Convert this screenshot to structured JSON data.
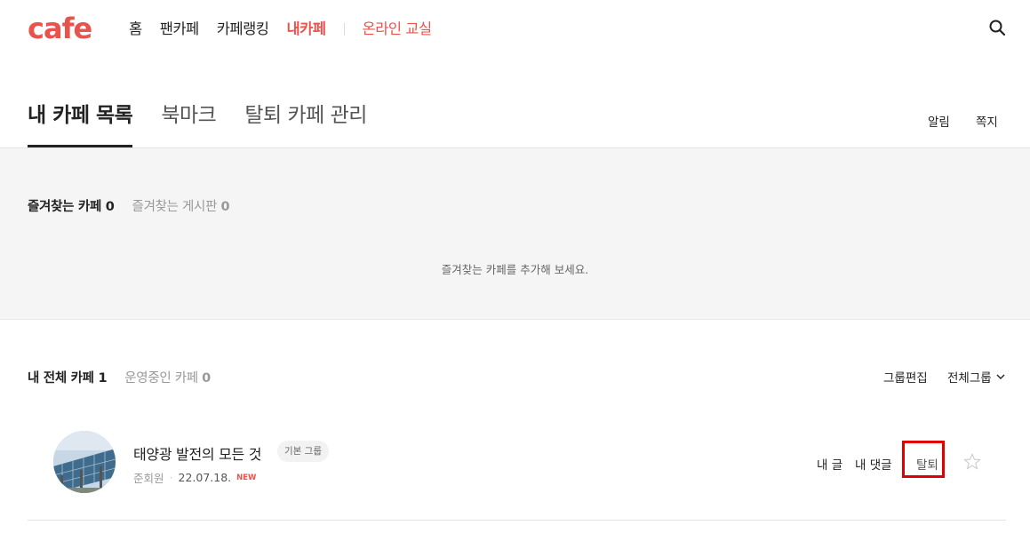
{
  "header": {
    "logo": "cafe",
    "nav": [
      {
        "label": "홈",
        "active": false
      },
      {
        "label": "팬카페",
        "active": false
      },
      {
        "label": "카페랭킹",
        "active": false
      },
      {
        "label": "내카페",
        "active": true
      }
    ],
    "nav_extra": "온라인 교실",
    "search_icon": "search-icon"
  },
  "tabs": {
    "my_list": "내 카페 목록",
    "bookmark": "북마크",
    "withdrawn": "탈퇴 카페 관리",
    "alarm": "알림",
    "note": "쪽지"
  },
  "favorites": {
    "cafes_label": "즐겨찾는 카페",
    "cafes_count": "0",
    "boards_label": "즐겨찾는 게시판",
    "boards_count": "0",
    "empty_message": "즐겨찾는 카페를 추가해 보세요."
  },
  "my_cafes": {
    "all_label": "내 전체 카페",
    "all_count": "1",
    "managed_label": "운영중인 카페",
    "managed_count": "0",
    "group_edit": "그룹편집",
    "group_select": "전체그룹",
    "items": [
      {
        "name": "태양광 발전의 모든 것",
        "group_badge": "기본 그룹",
        "level": "준회원",
        "date": "22.07.18.",
        "new_badge": "NEW",
        "my_posts": "내 글",
        "my_comments": "내 댓글",
        "leave": "탈퇴"
      }
    ]
  },
  "colors": {
    "brand": "#e8534c",
    "highlight_box": "#e00000"
  }
}
